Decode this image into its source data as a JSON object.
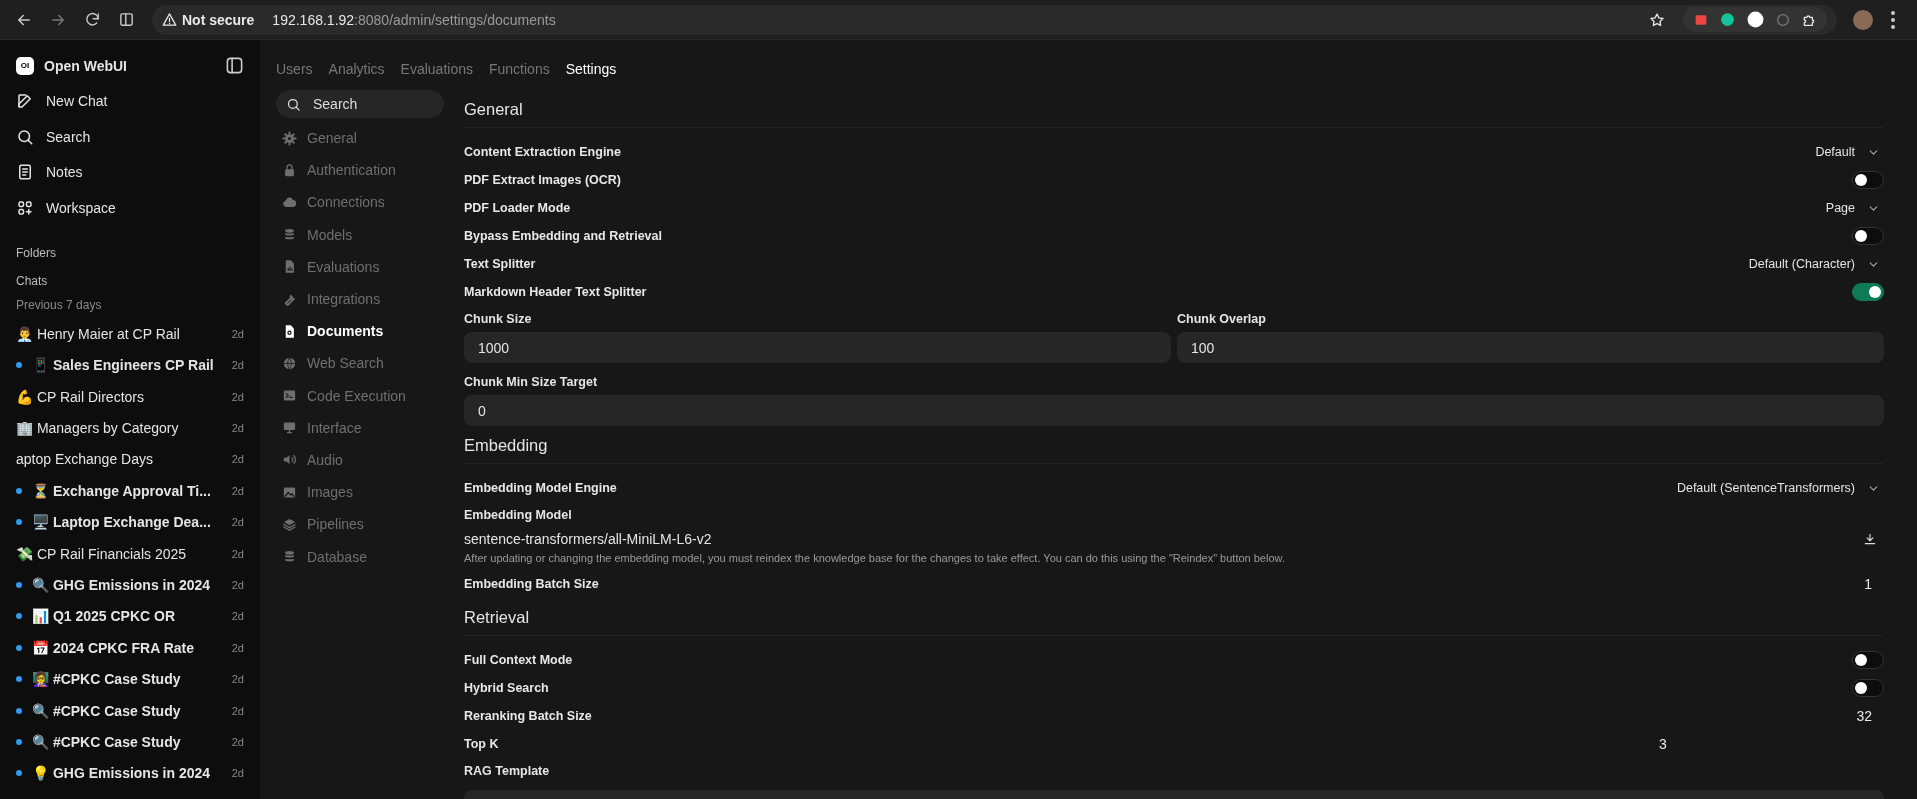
{
  "browser": {
    "security": "Not secure",
    "url_host": "192.168.1.92",
    "url_path": ":8080/admin/settings/documents"
  },
  "sidebar": {
    "app_name": "Open WebUI",
    "logo": "OI",
    "actions": [
      {
        "label": "New Chat"
      },
      {
        "label": "Search"
      },
      {
        "label": "Notes"
      },
      {
        "label": "Workspace"
      }
    ],
    "folders_label": "Folders",
    "chats_label": "Chats",
    "group_label": "Previous 7 days",
    "chats": [
      {
        "title": "👨‍💼 Henry Maier at CP Rail",
        "time": "2d",
        "unread": false
      },
      {
        "title": "📱 Sales Engineers CP Rail",
        "time": "2d",
        "unread": true
      },
      {
        "title": "💪 CP Rail Directors",
        "time": "2d",
        "unread": false
      },
      {
        "title": "🏢 Managers by Category",
        "time": "2d",
        "unread": false
      },
      {
        "title": "aptop Exchange Days",
        "time": "2d",
        "unread": false
      },
      {
        "title": "⏳ Exchange Approval Ti...",
        "time": "2d",
        "unread": true
      },
      {
        "title": "🖥️ Laptop Exchange Dea...",
        "time": "2d",
        "unread": true
      },
      {
        "title": "💸 CP Rail Financials 2025",
        "time": "2d",
        "unread": false
      },
      {
        "title": "🔍 GHG Emissions in 2024",
        "time": "2d",
        "unread": true
      },
      {
        "title": "📊 Q1 2025 CPKC OR",
        "time": "2d",
        "unread": true
      },
      {
        "title": "📅 2024 CPKC FRA Rate",
        "time": "2d",
        "unread": true
      },
      {
        "title": "👩‍🏫 #CPKC Case Study",
        "time": "2d",
        "unread": true
      },
      {
        "title": "🔍 #CPKC Case Study",
        "time": "2d",
        "unread": true
      },
      {
        "title": "🔍 #CPKC Case Study",
        "time": "2d",
        "unread": true
      },
      {
        "title": "💡 GHG Emissions in 2024",
        "time": "2d",
        "unread": true
      }
    ]
  },
  "admin_tabs": [
    {
      "label": "Users",
      "selected": false
    },
    {
      "label": "Analytics",
      "selected": false
    },
    {
      "label": "Evaluations",
      "selected": false
    },
    {
      "label": "Functions",
      "selected": false
    },
    {
      "label": "Settings",
      "selected": true
    }
  ],
  "settings_search": {
    "placeholder": "Search"
  },
  "settings_nav": [
    {
      "label": "General",
      "selected": false
    },
    {
      "label": "Authentication",
      "selected": false
    },
    {
      "label": "Connections",
      "selected": false
    },
    {
      "label": "Models",
      "selected": false
    },
    {
      "label": "Evaluations",
      "selected": false
    },
    {
      "label": "Integrations",
      "selected": false
    },
    {
      "label": "Documents",
      "selected": true
    },
    {
      "label": "Web Search",
      "selected": false
    },
    {
      "label": "Code Execution",
      "selected": false
    },
    {
      "label": "Interface",
      "selected": false
    },
    {
      "label": "Audio",
      "selected": false
    },
    {
      "label": "Images",
      "selected": false
    },
    {
      "label": "Pipelines",
      "selected": false
    },
    {
      "label": "Database",
      "selected": false
    }
  ],
  "sections": [
    {
      "title": "General",
      "rows": [
        {
          "kind": "select",
          "label": "Content Extraction Engine",
          "value": "Default"
        },
        {
          "kind": "toggle",
          "label": "PDF Extract Images (OCR)",
          "on": false
        },
        {
          "kind": "select",
          "label": "PDF Loader Mode",
          "value": "Page"
        },
        {
          "kind": "toggle",
          "label": "Bypass Embedding and Retrieval",
          "on": false
        },
        {
          "kind": "select",
          "label": "Text Splitter",
          "value": "Default (Character)"
        },
        {
          "kind": "toggle",
          "label": "Markdown Header Text Splitter",
          "on": true
        },
        {
          "kind": "input_pair",
          "fields": [
            {
              "label": "Chunk Size",
              "value": "1000"
            },
            {
              "label": "Chunk Overlap",
              "value": "100"
            }
          ]
        },
        {
          "kind": "input",
          "label": "Chunk Min Size Target",
          "value": "0"
        }
      ]
    },
    {
      "title": "Embedding",
      "rows": [
        {
          "kind": "select",
          "label": "Embedding Model Engine",
          "value": "Default (SentenceTransformers)"
        },
        {
          "kind": "model",
          "label": "Embedding Model",
          "value": "sentence-transformers/all-MiniLM-L6-v2",
          "note": "After updating or changing the embedding model, you must reindex the knowledge base for the changes to take effect. You can do this using the \"Reindex\" button below."
        },
        {
          "kind": "number",
          "label": "Embedding Batch Size",
          "value": "1"
        }
      ]
    },
    {
      "title": "Retrieval",
      "rows": [
        {
          "kind": "toggle",
          "label": "Full Context Mode",
          "on": false
        },
        {
          "kind": "toggle",
          "label": "Hybrid Search",
          "on": false
        },
        {
          "kind": "number",
          "label": "Reranking Batch Size",
          "value": "32"
        },
        {
          "kind": "number_wide",
          "label": "Top K",
          "value": "3"
        },
        {
          "kind": "textarea",
          "label": "RAG Template"
        }
      ]
    }
  ]
}
